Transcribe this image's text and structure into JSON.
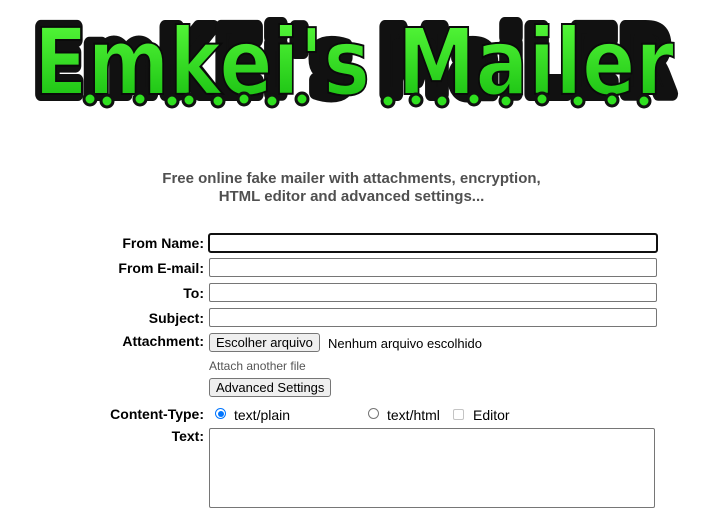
{
  "logo": {
    "text": "Emkei's Mailer"
  },
  "tagline": {
    "line1": "Free online fake mailer with attachments, encryption,",
    "line2": "HTML editor and advanced settings..."
  },
  "form": {
    "from_name_label": "From Name:",
    "from_name_value": "",
    "from_email_label": "From E-mail:",
    "from_email_value": "",
    "to_label": "To:",
    "to_value": "",
    "subject_label": "Subject:",
    "subject_value": "",
    "attachment_label": "Attachment:",
    "choose_file_label": "Escolher arquivo",
    "no_file_text": "Nenhum arquivo escolhido",
    "attach_another": "Attach another file",
    "advanced_settings_label": "Advanced Settings",
    "content_type_label": "Content-Type:",
    "content_type_options": [
      "text/plain",
      "text/html"
    ],
    "content_type_selected": "text/plain",
    "editor_label": "Editor",
    "editor_checked": false,
    "text_label": "Text:",
    "text_value": ""
  },
  "colors": {
    "logo_fill": "#22dd1a",
    "logo_outline": "#111111",
    "radio_accent": "#0075ff"
  }
}
